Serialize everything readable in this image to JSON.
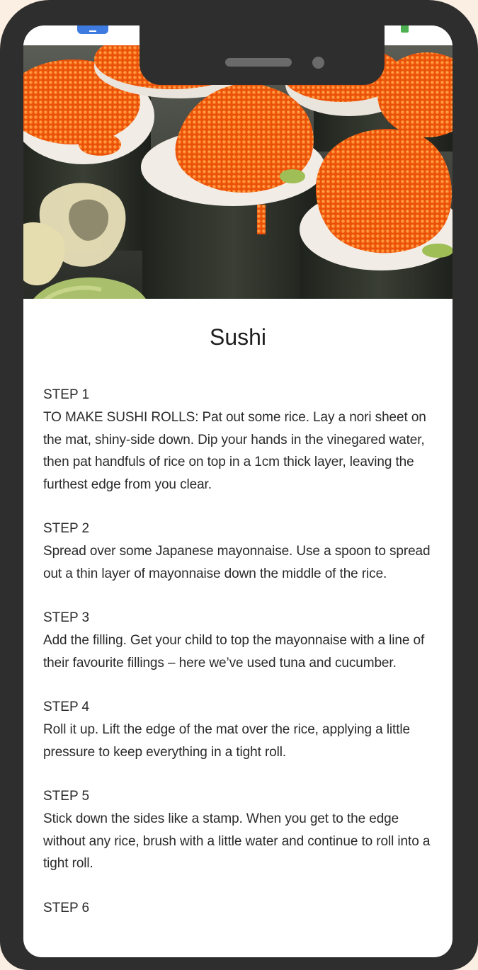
{
  "recipe": {
    "title": "Sushi",
    "image_alt": "Sushi rolls topped with orange fish roe"
  },
  "steps": [
    {
      "label": "STEP 1",
      "text": "TO MAKE SUSHI ROLLS: Pat out some rice. Lay a nori sheet on the mat, shiny-side down. Dip your hands in the vinegared water, then pat handfuls of rice on top in a 1cm thick layer, leaving the furthest edge from you clear."
    },
    {
      "label": "STEP 2",
      "text": "Spread over some Japanese mayonnaise. Use a spoon to spread out a thin layer of mayonnaise down the middle of the rice."
    },
    {
      "label": "STEP 3",
      "text": "Add the filling. Get your child to top the mayonnaise with a line of their favourite fillings – here we’ve used tuna and cucumber."
    },
    {
      "label": "STEP 4",
      "text": "Roll it up. Lift the edge of the mat over the rice, applying a little pressure to keep everything in a tight roll."
    },
    {
      "label": "STEP 5",
      "text": "Stick down the sides like a stamp. When you get to the edge without any rice, brush with a little water and continue to roll into a tight roll."
    },
    {
      "label": "STEP 6",
      "text": ""
    }
  ],
  "colors": {
    "phone_frame": "#2e2e2e",
    "roe_orange": "#f2600f",
    "nori_dark": "#2b2f29",
    "rice_white": "#f1ede6",
    "wasabi_green": "#a9bf6b"
  }
}
